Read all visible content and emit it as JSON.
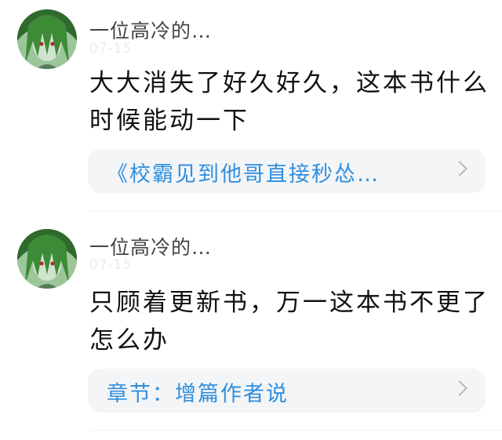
{
  "comments": [
    {
      "username": "一位高冷的…",
      "date": "07-15",
      "text": "大大消失了好久好久，这本书什么时候能动一下",
      "link": "《校霸见到他哥直接秒怂…"
    },
    {
      "username": "一位高冷的…",
      "date": "07-15",
      "text": "只顾着更新书，万一这本书不更了怎么办",
      "link": "章节：增篇作者说"
    }
  ],
  "colors": {
    "link": "#2f8fde",
    "card_bg": "#f4f5f7",
    "avatar_green": "#3f7a3a"
  },
  "icons": {
    "avatar": "anime-avatar-green-hair",
    "chevron": "chevron-right-icon"
  }
}
